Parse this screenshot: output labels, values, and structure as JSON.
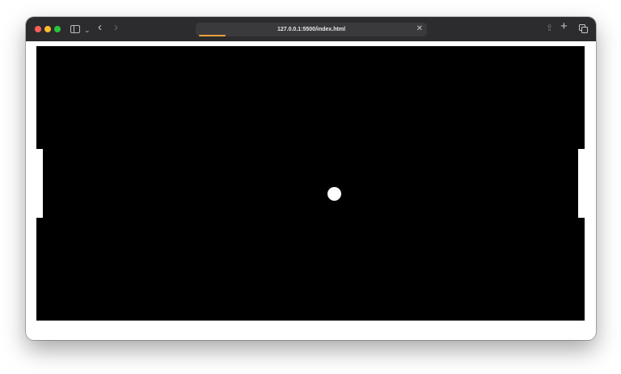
{
  "browser": {
    "url": "127.0.0.1:5500/index.html",
    "load_progress_fraction": 0.12,
    "accent_color": "#f2a33a"
  },
  "toolbar": {
    "icons": [
      "sidebar-icon",
      "chevron-down-icon",
      "back-arrow-icon",
      "forward-arrow-icon",
      "share-icon",
      "new-tab-icon",
      "tab-overview-icon"
    ],
    "glyphs": {
      "chevron_down": "⌄",
      "back": "‹",
      "forward": "›",
      "close": "✕",
      "share": "⇪",
      "plus": "+"
    }
  },
  "game": {
    "type": "pong",
    "background_color": "#000000",
    "foreground_color": "#ffffff",
    "objects": [
      "left-paddle",
      "right-paddle",
      "ball"
    ]
  }
}
